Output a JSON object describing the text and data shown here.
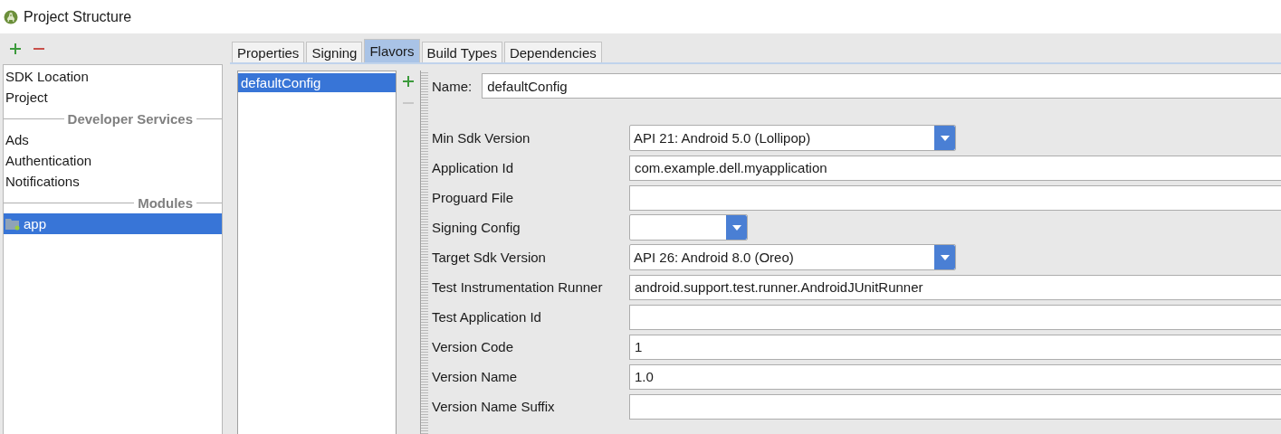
{
  "window": {
    "title": "Project Structure"
  },
  "sidebar": {
    "items": [
      {
        "kind": "item",
        "label": "SDK Location",
        "selected": false
      },
      {
        "kind": "item",
        "label": "Project",
        "selected": false
      },
      {
        "kind": "header",
        "label": "Developer Services"
      },
      {
        "kind": "item",
        "label": "Ads",
        "selected": false
      },
      {
        "kind": "item",
        "label": "Authentication",
        "selected": false
      },
      {
        "kind": "item",
        "label": "Notifications",
        "selected": false
      },
      {
        "kind": "header",
        "label": "Modules"
      },
      {
        "kind": "module",
        "label": "app",
        "selected": true
      }
    ]
  },
  "tabs": [
    {
      "label": "Properties",
      "selected": false
    },
    {
      "label": "Signing",
      "selected": false
    },
    {
      "label": "Flavors",
      "selected": true
    },
    {
      "label": "Build Types",
      "selected": false
    },
    {
      "label": "Dependencies",
      "selected": false
    }
  ],
  "flavors": [
    {
      "label": "defaultConfig",
      "selected": true
    }
  ],
  "name_field": {
    "label": "Name:",
    "value": "defaultConfig"
  },
  "fields": [
    {
      "kind": "dropdown",
      "label": "Min Sdk Version",
      "value": "API 21: Android 5.0 (Lollipop)"
    },
    {
      "kind": "text",
      "label": "Application Id",
      "value": "com.example.dell.myapplication"
    },
    {
      "kind": "text",
      "label": "Proguard File"
    },
    {
      "kind": "combo",
      "label": "Signing Config"
    },
    {
      "kind": "dropdown",
      "label": "Target Sdk Version",
      "value": "API 26: Android 8.0 (Oreo)"
    },
    {
      "kind": "text",
      "label": "Test Instrumentation Runner",
      "value": "android.support.test.runner.AndroidJUnitRunner"
    },
    {
      "kind": "text",
      "label": "Test Application Id"
    },
    {
      "kind": "text",
      "label": "Version Code",
      "value": "1"
    },
    {
      "kind": "text",
      "label": "Version Name",
      "value": "1.0"
    },
    {
      "kind": "text",
      "label": "Version Name Suffix"
    }
  ]
}
